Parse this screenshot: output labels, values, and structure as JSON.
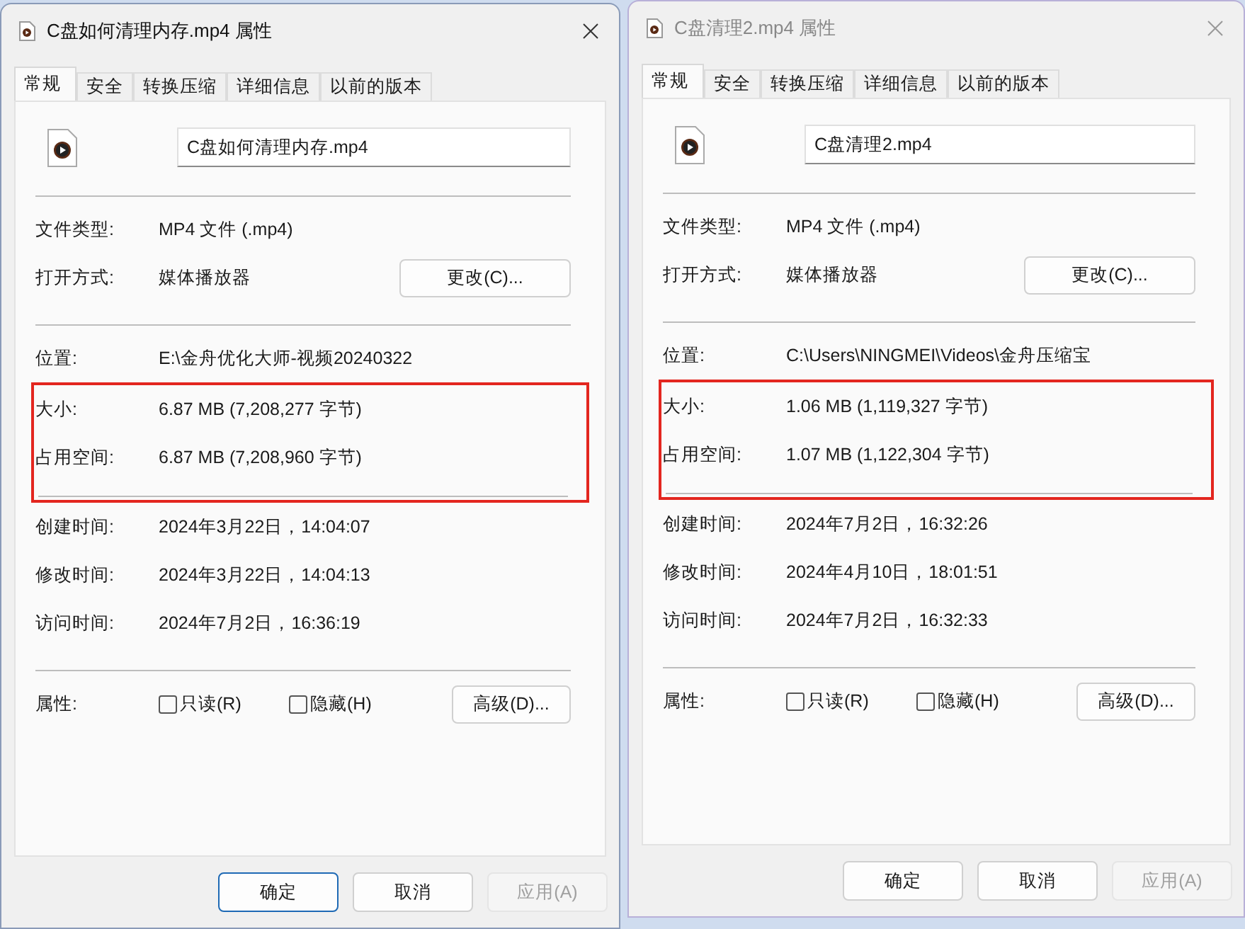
{
  "dialogs": [
    {
      "title": "C盘如何清理内存.mp4 属性",
      "active": true,
      "tabs": [
        {
          "label": "常规",
          "selected": true
        },
        {
          "label": "安全",
          "selected": false
        },
        {
          "label": "转换压缩",
          "selected": false
        },
        {
          "label": "详细信息",
          "selected": false
        },
        {
          "label": "以前的版本",
          "selected": false
        }
      ],
      "filename": "C盘如何清理内存.mp4",
      "sections": [
        {
          "highlighted": false,
          "divider": true,
          "rows": [
            {
              "label": "文件类型:",
              "value": "MP4 文件 (.mp4)"
            },
            {
              "label": "打开方式:",
              "value": "媒体播放器",
              "button": "更改(C)..."
            }
          ]
        },
        {
          "highlighted": false,
          "divider": false,
          "rows": [
            {
              "label": "位置:",
              "value": "E:\\金舟优化大师-视频20240322"
            }
          ]
        },
        {
          "highlighted": true,
          "divider": true,
          "rows": [
            {
              "label": "大小:",
              "value": "6.87 MB (7,208,277 字节)"
            },
            {
              "label": "占用空间:",
              "value": "6.87 MB (7,208,960 字节)"
            }
          ]
        },
        {
          "highlighted": false,
          "divider": true,
          "rows": [
            {
              "label": "创建时间:",
              "value": "2024年3月22日，14:04:07"
            },
            {
              "label": "修改时间:",
              "value": "2024年3月22日，14:04:13"
            },
            {
              "label": "访问时间:",
              "value": "2024年7月2日，16:36:19"
            }
          ]
        }
      ],
      "attributes": {
        "label": "属性:",
        "checkboxes": [
          {
            "label": "只读(R)",
            "checked": false
          },
          {
            "label": "隐藏(H)",
            "checked": false
          }
        ],
        "button": "高级(D)..."
      },
      "buttons": [
        {
          "label": "确定",
          "default": true,
          "disabled": false
        },
        {
          "label": "取消",
          "default": false,
          "disabled": false
        },
        {
          "label": "应用(A)",
          "default": false,
          "disabled": true
        }
      ]
    },
    {
      "title": "C盘清理2.mp4 属性",
      "active": false,
      "tabs": [
        {
          "label": "常规",
          "selected": true
        },
        {
          "label": "安全",
          "selected": false
        },
        {
          "label": "转换压缩",
          "selected": false
        },
        {
          "label": "详细信息",
          "selected": false
        },
        {
          "label": "以前的版本",
          "selected": false
        }
      ],
      "filename": "C盘清理2.mp4",
      "sections": [
        {
          "highlighted": false,
          "divider": true,
          "rows": [
            {
              "label": "文件类型:",
              "value": "MP4 文件 (.mp4)"
            },
            {
              "label": "打开方式:",
              "value": "媒体播放器",
              "button": "更改(C)..."
            }
          ]
        },
        {
          "highlighted": false,
          "divider": false,
          "rows": [
            {
              "label": "位置:",
              "value": "C:\\Users\\NINGMEI\\Videos\\金舟压缩宝"
            }
          ]
        },
        {
          "highlighted": true,
          "divider": true,
          "rows": [
            {
              "label": "大小:",
              "value": "1.06 MB (1,119,327 字节)"
            },
            {
              "label": "占用空间:",
              "value": "1.07 MB (1,122,304 字节)"
            }
          ]
        },
        {
          "highlighted": false,
          "divider": true,
          "rows": [
            {
              "label": "创建时间:",
              "value": "2024年7月2日，16:32:26"
            },
            {
              "label": "修改时间:",
              "value": "2024年4月10日，18:01:51"
            },
            {
              "label": "访问时间:",
              "value": "2024年7月2日，16:32:33"
            }
          ]
        }
      ],
      "attributes": {
        "label": "属性:",
        "checkboxes": [
          {
            "label": "只读(R)",
            "checked": false
          },
          {
            "label": "隐藏(H)",
            "checked": false
          }
        ],
        "button": "高级(D)..."
      },
      "buttons": [
        {
          "label": "确定",
          "default": false,
          "disabled": false
        },
        {
          "label": "取消",
          "default": false,
          "disabled": false
        },
        {
          "label": "应用(A)",
          "default": false,
          "disabled": true
        }
      ]
    }
  ]
}
